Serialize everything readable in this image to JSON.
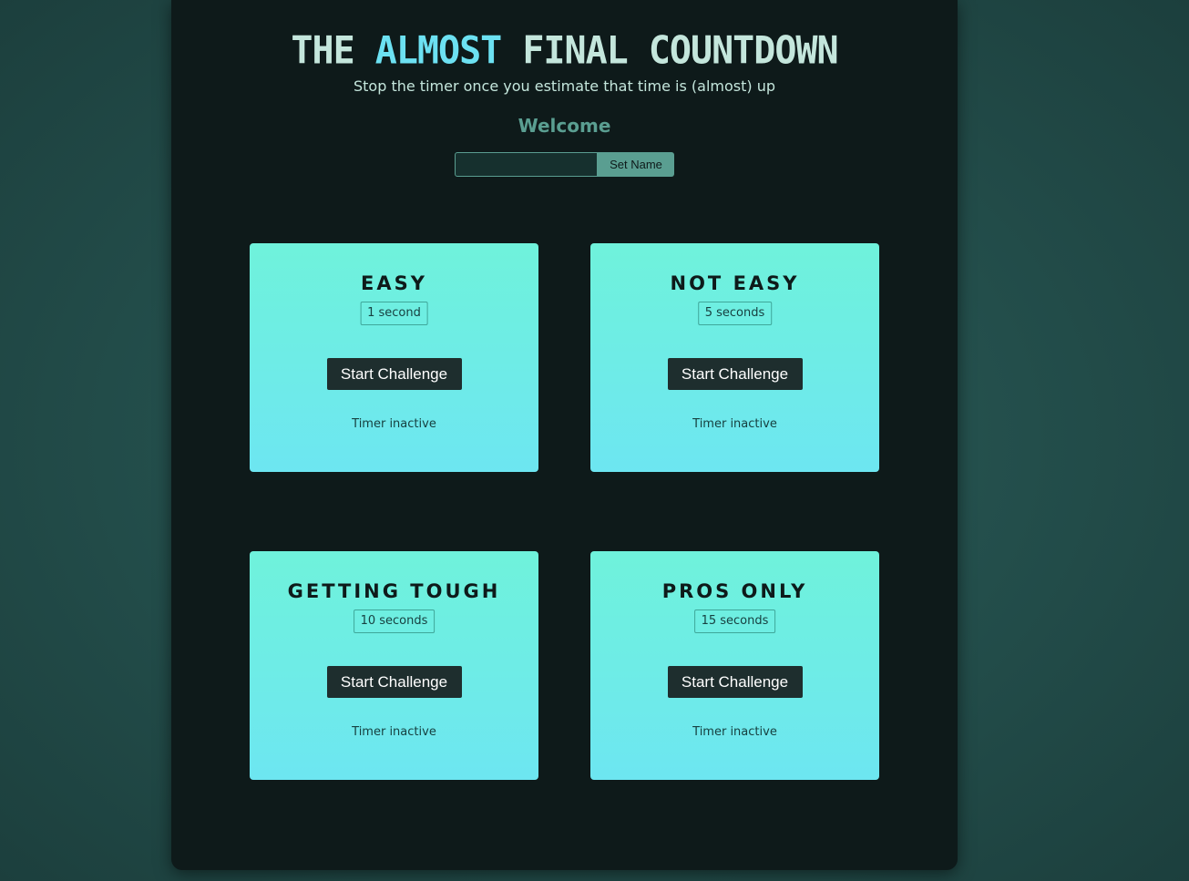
{
  "header": {
    "title_part1": "THE ",
    "title_accent": "ALMOST",
    "title_part2": " FINAL COUNTDOWN",
    "subtitle": "Stop the timer once you estimate that time is (almost) up",
    "welcome": "Welcome"
  },
  "name_form": {
    "input_value": "",
    "input_placeholder": "",
    "button_label": "Set Name"
  },
  "challenges": [
    {
      "title": "EASY",
      "time": "1 second",
      "button_label": "Start Challenge",
      "status": "Timer inactive"
    },
    {
      "title": "NOT EASY",
      "time": "5 seconds",
      "button_label": "Start Challenge",
      "status": "Timer inactive"
    },
    {
      "title": "GETTING TOUGH",
      "time": "10 seconds",
      "button_label": "Start Challenge",
      "status": "Timer inactive"
    },
    {
      "title": "PROS ONLY",
      "time": "15 seconds",
      "button_label": "Start Challenge",
      "status": "Timer inactive"
    }
  ],
  "colors": {
    "background": "#24504d",
    "panel": "#0e1a1a",
    "accent": "#6ce1f2",
    "title_text": "#c4e6dc",
    "muted": "#5a9e91",
    "card_top": "#6ff2db",
    "card_bottom": "#6de6f1",
    "button_dark": "#1e2e2e"
  }
}
